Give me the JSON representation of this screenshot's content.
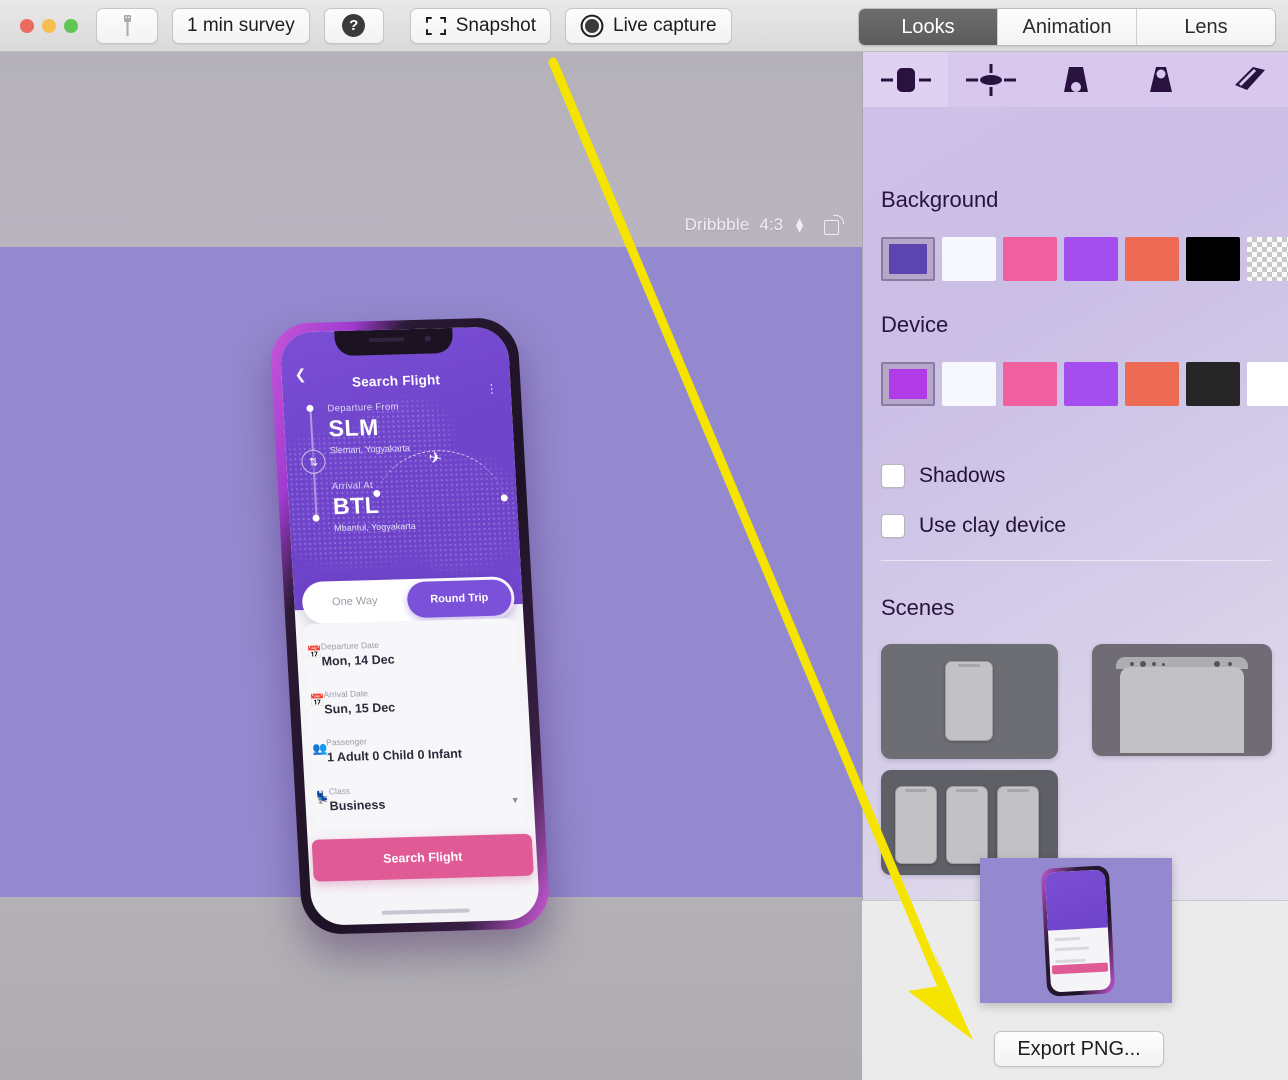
{
  "window": {
    "traffic_lights": [
      "close",
      "minimize",
      "zoom"
    ],
    "toolbar": {
      "usb_button_icon": "usb-cable-icon",
      "survey_label": "1 min survey",
      "help_label": "?",
      "snapshot_label": "Snapshot",
      "snapshot_icon": "crop-frame-icon",
      "live_capture_label": "Live capture",
      "live_capture_icon": "record-circle-icon"
    },
    "tabs": [
      {
        "label": "Looks",
        "active": true
      },
      {
        "label": "Animation",
        "active": false
      },
      {
        "label": "Lens",
        "active": false
      }
    ]
  },
  "canvas": {
    "aspect": {
      "preset_label": "Dribbble",
      "ratio_label": "4:3",
      "stepper_icon": "stepper-up-down-icon",
      "rotate_icon": "rotate-canvas-icon"
    },
    "artboard_color": "#9488ce",
    "mockup": {
      "app_screen": {
        "back_icon": "chevron-left-icon",
        "title": "Search Flight",
        "overflow_icon": "kebab-menu-icon",
        "departure_label": "Departure From",
        "departure_code": "SLM",
        "departure_city": "Sleman, Yogyakarta",
        "swap_icon": "swap-vertical-icon",
        "arrival_label": "Arrival At",
        "arrival_code": "BTL",
        "arrival_city": "Mbantul, Yogyakarta",
        "plane_icon": "airplane-icon",
        "trip_toggle": {
          "one_way": "One Way",
          "round_trip": "Round Trip",
          "selected": "Round Trip"
        },
        "fields": [
          {
            "icon": "calendar-icon",
            "label": "Departure Date",
            "value": "Mon, 14 Dec"
          },
          {
            "icon": "calendar-icon",
            "label": "Arrival Date",
            "value": "Sun, 15 Dec"
          },
          {
            "icon": "passengers-icon",
            "label": "Passenger",
            "value": "1 Adult   0 Child   0 Infant"
          },
          {
            "icon": "seat-icon",
            "label": "Class",
            "value": "Business"
          }
        ],
        "cta_label": "Search Flight",
        "cta_color": "#e05a96"
      }
    }
  },
  "panel": {
    "perspectives": [
      {
        "name": "flat-side-icon",
        "selected": true
      },
      {
        "name": "flat-top-icon",
        "selected": false
      },
      {
        "name": "perspective-front-icon",
        "selected": false
      },
      {
        "name": "perspective-back-icon",
        "selected": false
      },
      {
        "name": "perspective-angled-icon",
        "selected": false
      }
    ],
    "background": {
      "title": "Background",
      "swatches": [
        {
          "name": "purple",
          "color": "#5b45b0",
          "selected": true
        },
        {
          "name": "white",
          "color": "#f6f8fd",
          "selected": false
        },
        {
          "name": "pink",
          "color": "#f0609f",
          "selected": false
        },
        {
          "name": "violet",
          "color": "#a44ef0",
          "selected": false
        },
        {
          "name": "coral",
          "color": "#ed6a55",
          "selected": false
        },
        {
          "name": "black",
          "color": "#000000",
          "selected": false
        },
        {
          "name": "transparent",
          "color": "transparent",
          "selected": false
        }
      ]
    },
    "device": {
      "title": "Device",
      "swatches": [
        {
          "name": "purple",
          "color": "#b23be8",
          "selected": true
        },
        {
          "name": "white",
          "color": "#f6f8fd",
          "selected": false
        },
        {
          "name": "pink",
          "color": "#f0609f",
          "selected": false
        },
        {
          "name": "violet",
          "color": "#a44ef0",
          "selected": false
        },
        {
          "name": "coral",
          "color": "#ed6a55",
          "selected": false
        },
        {
          "name": "graphite",
          "color": "#262626",
          "selected": false
        },
        {
          "name": "white2",
          "color": "#ffffff",
          "selected": false
        }
      ]
    },
    "options": [
      {
        "label": "Shadows",
        "checked": false
      },
      {
        "label": "Use clay device",
        "checked": false
      }
    ],
    "scenes": {
      "title": "Scenes",
      "items": [
        {
          "name": "single-phone-scene"
        },
        {
          "name": "laptop-scene"
        },
        {
          "name": "three-phones-scene"
        }
      ]
    }
  },
  "export": {
    "preview_name": "export-preview-thumbnail",
    "button_label": "Export PNG..."
  },
  "annotation": {
    "arrow_color": "#f5e400",
    "points_to": "Export PNG... button"
  }
}
